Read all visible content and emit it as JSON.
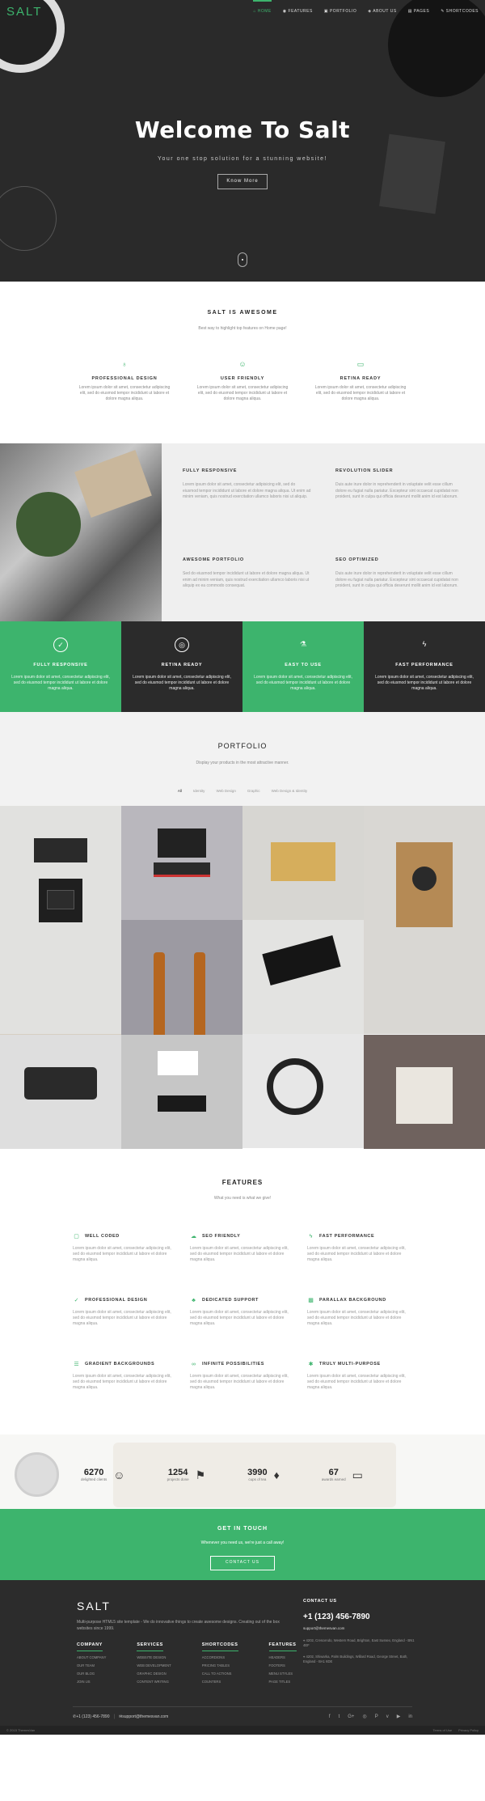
{
  "brand": {
    "logo": "SALT"
  },
  "nav": {
    "items": [
      {
        "label": "HOME",
        "icon": "home-icon"
      },
      {
        "label": "FEATURES",
        "icon": "features-icon"
      },
      {
        "label": "PORTFOLIO",
        "icon": "portfolio-icon"
      },
      {
        "label": "ABOUT US",
        "icon": "info-icon"
      },
      {
        "label": "PAGES",
        "icon": "pages-icon"
      },
      {
        "label": "SHORTCODES",
        "icon": "pencil-icon"
      }
    ]
  },
  "hero": {
    "title": "Welcome To Salt",
    "subtitle": "Your one stop solution for a stunning website!",
    "button": "Know More"
  },
  "awesome": {
    "title": "SALT IS AWESOME",
    "subtitle": "Best way to highlight top features on Home page!",
    "items": [
      {
        "title": "PROFESSIONAL DESIGN",
        "desc": "Lorem ipsum dolor sit amet, consectetur adipiscing elit, sed do eiusmod tempor incididunt ut labore et dolore magna aliqua."
      },
      {
        "title": "USER FRIENDLY",
        "desc": "Lorem ipsum dolor sit amet, consectetur adipiscing elit, sed do eiusmod tempor incididunt ut labore et dolore magna aliqua."
      },
      {
        "title": "RETINA READY",
        "desc": "Lorem ipsum dolor sit amet, consectetur adipiscing elit, sed do eiusmod tempor incididunt ut labore et dolore magna aliqua."
      }
    ]
  },
  "split": {
    "items": [
      {
        "title": "FULLY RESPONSIVE",
        "desc": "Lorem ipsum dolor sit amet, consectetur adipisicing elit, sed do eiusmod tempor incididunt ut labore et dolore magna aliqua. Ut enim ad minim veniam, quis nostrud exercitation ullamco laboris nisi ut aliquip."
      },
      {
        "title": "REVOLUTION SLIDER",
        "desc": "Duis aute irure dolor in reprehenderit in voluptate velit esse cillum dolore eu fugiat nulla pariatur. Excepteur sint occaecat cupidatat non proident, sunt in culpa qui officia deserunt mollit anim id est laborum."
      },
      {
        "title": "AWESOME PORTFOLIO",
        "desc": "Sed do eiusmod tempor incididunt ut labore et dolore magna aliqua. Ut enim ad minim veniam, quis nostrud exercitation ullamco laboris nisi ut aliquip ex ea commodo consequat."
      },
      {
        "title": "SEO OPTIMIZED",
        "desc": "Duis aute irure dolor in reprehenderit in voluptate velit esse cillum dolore eu fugiat nulla pariatur. Excepteur sint occaecat cupidatat non proident, sunt in culpa qui officia deserunt mollit anim id est laborum."
      }
    ]
  },
  "tiles": [
    {
      "title": "FULLY RESPONSIVE",
      "icon": "check-icon",
      "desc": "Lorem ipsum dolor sit amet, consectetur adipiscing elit, sed do eiusmod tempor incididunt ut labore et dolore magna aliqua."
    },
    {
      "title": "RETINA READY",
      "icon": "eye-icon",
      "desc": "Lorem ipsum dolor sit amet, consectetur adipiscing elit, sed do eiusmod tempor incididunt ut labore et dolore magna aliqua."
    },
    {
      "title": "EASY TO USE",
      "icon": "flask-icon",
      "desc": "Lorem ipsum dolor sit amet, consectetur adipiscing elit, sed do eiusmod tempor incididunt ut labore et dolore magna aliqua."
    },
    {
      "title": "FAST PERFORMANCE",
      "icon": "bolt-icon",
      "desc": "Lorem ipsum dolor sit amet, consectetur adipiscing elit, sed do eiusmod tempor incididunt ut labore et dolore magna aliqua."
    }
  ],
  "portfolio": {
    "title": "PORTFOLIO",
    "subtitle": "Display your products in the most attractive manner.",
    "filters": [
      "All",
      "Identity",
      "Web Design",
      "Graphic",
      "Web Design & Identity"
    ]
  },
  "features": {
    "title": "FEATURES",
    "subtitle": "What you need is what we give!",
    "items": [
      {
        "title": "WELL CODED",
        "icon": "code-icon",
        "desc": "Lorem ipsum dolor sit amet, consectetur adipiscing elit, sed do eiusmod tempor incididunt ut labore et dolore magna aliqua."
      },
      {
        "title": "SEO FRIENDLY",
        "icon": "cloud-icon",
        "desc": "Lorem ipsum dolor sit amet, consectetur adipiscing elit, sed do eiusmod tempor incididunt ut labore et dolore magna aliqua."
      },
      {
        "title": "FAST PERFORMANCE",
        "icon": "bolt-icon",
        "desc": "Lorem ipsum dolor sit amet, consectetur adipiscing elit, sed do eiusmod tempor incididunt ut labore et dolore magna aliqua."
      },
      {
        "title": "PROFESSIONAL DESIGN",
        "icon": "check-circle-icon",
        "desc": "Lorem ipsum dolor sit amet, consectetur adipiscing elit, sed do eiusmod tempor incididunt ut labore et dolore magna aliqua."
      },
      {
        "title": "DEDICATED SUPPORT",
        "icon": "support-icon",
        "desc": "Lorem ipsum dolor sit amet, consectetur adipiscing elit, sed do eiusmod tempor incididunt ut labore et dolore magna aliqua."
      },
      {
        "title": "PARALLAX BACKGROUND",
        "icon": "image-icon",
        "desc": "Lorem ipsum dolor sit amet, consectetur adipiscing elit, sed do eiusmod tempor incididunt ut labore et dolore magna aliqua."
      },
      {
        "title": "GRADIENT BACKGROUNDS",
        "icon": "sliders-icon",
        "desc": "Lorem ipsum dolor sit amet, consectetur adipiscing elit, sed do eiusmod tempor incididunt ut labore et dolore magna aliqua."
      },
      {
        "title": "INFINITE POSSIBILITIES",
        "icon": "infinity-icon",
        "desc": "Lorem ipsum dolor sit amet, consectetur adipiscing elit, sed do eiusmod tempor incididunt ut labore et dolore magna aliqua."
      },
      {
        "title": "TRULY MULTI-PURPOSE",
        "icon": "asterisk-icon",
        "desc": "Lorem ipsum dolor sit amet, consectetur adipiscing elit, sed do eiusmod tempor incididunt ut labore et dolore magna aliqua."
      }
    ]
  },
  "stats": [
    {
      "value": "6270",
      "label": "delighted clients",
      "icon": "smile-icon"
    },
    {
      "value": "1254",
      "label": "projects done",
      "icon": "flag-icon"
    },
    {
      "value": "3990",
      "label": "cups of tea",
      "icon": "drop-icon"
    },
    {
      "value": "67",
      "label": "awards earned",
      "icon": "laptop-icon"
    }
  ],
  "contact": {
    "title": "GET IN TOUCH",
    "subtitle": "Whenever you need us, we're just a call away!",
    "button": "CONTACT US"
  },
  "footer": {
    "logo": "SALT",
    "about": "Multi-purpose HTML5 site template - We do innovative things to create awesome designs. Creating out of the box websites since 1999.",
    "columns": [
      {
        "title": "COMPANY",
        "items": [
          "ABOUT COMPANY",
          "OUR TEAM",
          "OUR BLOG",
          "JOIN US"
        ]
      },
      {
        "title": "SERVICES",
        "items": [
          "WEBSITE DESIGN",
          "WEB DEVELOPMENT",
          "GRAPHIC DESIGN",
          "CONTENT WRITING"
        ]
      },
      {
        "title": "SHORTCODES",
        "items": [
          "ACCORDIONS",
          "PRICING TABLES",
          "CALL TO ACTIONS",
          "COUNTERS"
        ]
      },
      {
        "title": "FEATURES",
        "items": [
          "HEADERS",
          "FOOTERS",
          "MENU STYLES",
          "PAGE TITLES"
        ]
      }
    ],
    "contact_title": "CONTACT US",
    "phone": "+1 (123) 456-7890",
    "email": "support@themesvan.com",
    "address1": "4202, Crescendo, Western Road, Brighton, East Sussex, England - BN1 4EF",
    "address2": "4202, Shiwarka, Palm Buildings, Willard Road, George Street, Bath, England - BA1 6DE",
    "bar_phone": "+1 (123) 456-7890",
    "bar_email": "support@themesvan.com",
    "copyright": "© 2015 ThemesVan",
    "links": [
      "Terms of Use",
      "Privacy Policy"
    ],
    "social": [
      "facebook-icon",
      "twitter-icon",
      "google-plus-icon",
      "instagram-icon",
      "pinterest-icon",
      "vimeo-icon",
      "youtube-icon",
      "linkedin-icon"
    ]
  },
  "colors": {
    "accent": "#3db46d",
    "dark": "#2b2b2b"
  }
}
